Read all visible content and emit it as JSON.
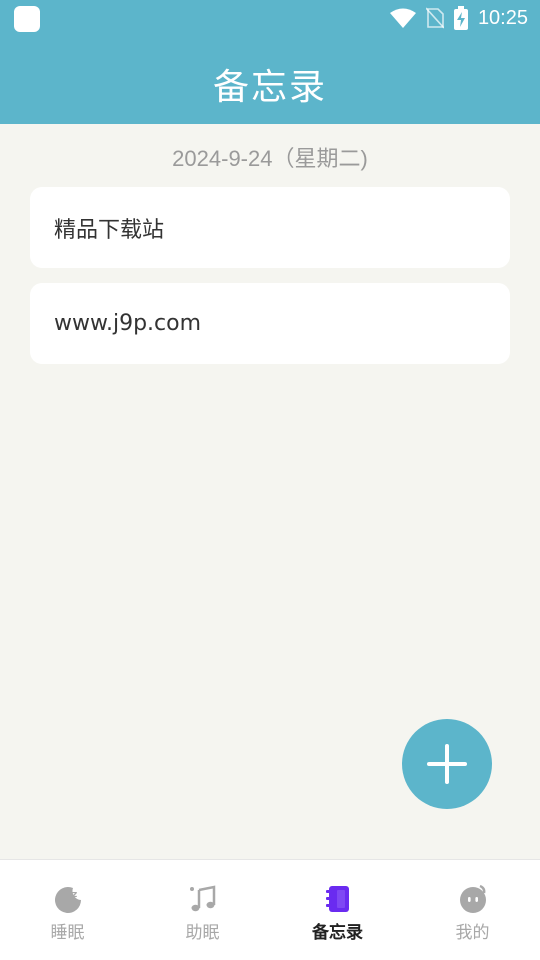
{
  "statusbar": {
    "time": "10:25"
  },
  "header": {
    "title": "备忘录"
  },
  "date": {
    "text": "2024-9-24（星期二)"
  },
  "memos": [
    {
      "text": "精品下载站"
    },
    {
      "text": "www.j9p.com"
    }
  ],
  "fab": {
    "icon": "plus-icon"
  },
  "tabs": [
    {
      "label": "睡眠",
      "icon": "sleep-moon-icon",
      "active": false
    },
    {
      "label": "助眠",
      "icon": "music-note-icon",
      "active": false
    },
    {
      "label": "备忘录",
      "icon": "notebook-icon",
      "active": true
    },
    {
      "label": "我的",
      "icon": "profile-face-icon",
      "active": false
    }
  ],
  "colors": {
    "brand": "#5cb5cb",
    "background": "#f5f5f0",
    "active_tab_icon": "#6a2bf0",
    "inactive_tab": "#a8a8a8"
  }
}
